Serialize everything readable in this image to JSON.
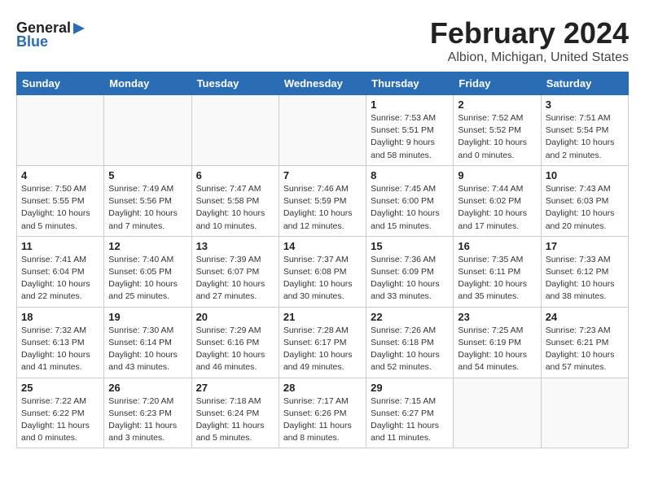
{
  "logo": {
    "general": "General",
    "blue": "Blue"
  },
  "header": {
    "month_year": "February 2024",
    "location": "Albion, Michigan, United States"
  },
  "days_of_week": [
    "Sunday",
    "Monday",
    "Tuesday",
    "Wednesday",
    "Thursday",
    "Friday",
    "Saturday"
  ],
  "weeks": [
    [
      {
        "day": "",
        "info": ""
      },
      {
        "day": "",
        "info": ""
      },
      {
        "day": "",
        "info": ""
      },
      {
        "day": "",
        "info": ""
      },
      {
        "day": "1",
        "info": "Sunrise: 7:53 AM\nSunset: 5:51 PM\nDaylight: 9 hours and 58 minutes."
      },
      {
        "day": "2",
        "info": "Sunrise: 7:52 AM\nSunset: 5:52 PM\nDaylight: 10 hours and 0 minutes."
      },
      {
        "day": "3",
        "info": "Sunrise: 7:51 AM\nSunset: 5:54 PM\nDaylight: 10 hours and 2 minutes."
      }
    ],
    [
      {
        "day": "4",
        "info": "Sunrise: 7:50 AM\nSunset: 5:55 PM\nDaylight: 10 hours and 5 minutes."
      },
      {
        "day": "5",
        "info": "Sunrise: 7:49 AM\nSunset: 5:56 PM\nDaylight: 10 hours and 7 minutes."
      },
      {
        "day": "6",
        "info": "Sunrise: 7:47 AM\nSunset: 5:58 PM\nDaylight: 10 hours and 10 minutes."
      },
      {
        "day": "7",
        "info": "Sunrise: 7:46 AM\nSunset: 5:59 PM\nDaylight: 10 hours and 12 minutes."
      },
      {
        "day": "8",
        "info": "Sunrise: 7:45 AM\nSunset: 6:00 PM\nDaylight: 10 hours and 15 minutes."
      },
      {
        "day": "9",
        "info": "Sunrise: 7:44 AM\nSunset: 6:02 PM\nDaylight: 10 hours and 17 minutes."
      },
      {
        "day": "10",
        "info": "Sunrise: 7:43 AM\nSunset: 6:03 PM\nDaylight: 10 hours and 20 minutes."
      }
    ],
    [
      {
        "day": "11",
        "info": "Sunrise: 7:41 AM\nSunset: 6:04 PM\nDaylight: 10 hours and 22 minutes."
      },
      {
        "day": "12",
        "info": "Sunrise: 7:40 AM\nSunset: 6:05 PM\nDaylight: 10 hours and 25 minutes."
      },
      {
        "day": "13",
        "info": "Sunrise: 7:39 AM\nSunset: 6:07 PM\nDaylight: 10 hours and 27 minutes."
      },
      {
        "day": "14",
        "info": "Sunrise: 7:37 AM\nSunset: 6:08 PM\nDaylight: 10 hours and 30 minutes."
      },
      {
        "day": "15",
        "info": "Sunrise: 7:36 AM\nSunset: 6:09 PM\nDaylight: 10 hours and 33 minutes."
      },
      {
        "day": "16",
        "info": "Sunrise: 7:35 AM\nSunset: 6:11 PM\nDaylight: 10 hours and 35 minutes."
      },
      {
        "day": "17",
        "info": "Sunrise: 7:33 AM\nSunset: 6:12 PM\nDaylight: 10 hours and 38 minutes."
      }
    ],
    [
      {
        "day": "18",
        "info": "Sunrise: 7:32 AM\nSunset: 6:13 PM\nDaylight: 10 hours and 41 minutes."
      },
      {
        "day": "19",
        "info": "Sunrise: 7:30 AM\nSunset: 6:14 PM\nDaylight: 10 hours and 43 minutes."
      },
      {
        "day": "20",
        "info": "Sunrise: 7:29 AM\nSunset: 6:16 PM\nDaylight: 10 hours and 46 minutes."
      },
      {
        "day": "21",
        "info": "Sunrise: 7:28 AM\nSunset: 6:17 PM\nDaylight: 10 hours and 49 minutes."
      },
      {
        "day": "22",
        "info": "Sunrise: 7:26 AM\nSunset: 6:18 PM\nDaylight: 10 hours and 52 minutes."
      },
      {
        "day": "23",
        "info": "Sunrise: 7:25 AM\nSunset: 6:19 PM\nDaylight: 10 hours and 54 minutes."
      },
      {
        "day": "24",
        "info": "Sunrise: 7:23 AM\nSunset: 6:21 PM\nDaylight: 10 hours and 57 minutes."
      }
    ],
    [
      {
        "day": "25",
        "info": "Sunrise: 7:22 AM\nSunset: 6:22 PM\nDaylight: 11 hours and 0 minutes."
      },
      {
        "day": "26",
        "info": "Sunrise: 7:20 AM\nSunset: 6:23 PM\nDaylight: 11 hours and 3 minutes."
      },
      {
        "day": "27",
        "info": "Sunrise: 7:18 AM\nSunset: 6:24 PM\nDaylight: 11 hours and 5 minutes."
      },
      {
        "day": "28",
        "info": "Sunrise: 7:17 AM\nSunset: 6:26 PM\nDaylight: 11 hours and 8 minutes."
      },
      {
        "day": "29",
        "info": "Sunrise: 7:15 AM\nSunset: 6:27 PM\nDaylight: 11 hours and 11 minutes."
      },
      {
        "day": "",
        "info": ""
      },
      {
        "day": "",
        "info": ""
      }
    ]
  ]
}
